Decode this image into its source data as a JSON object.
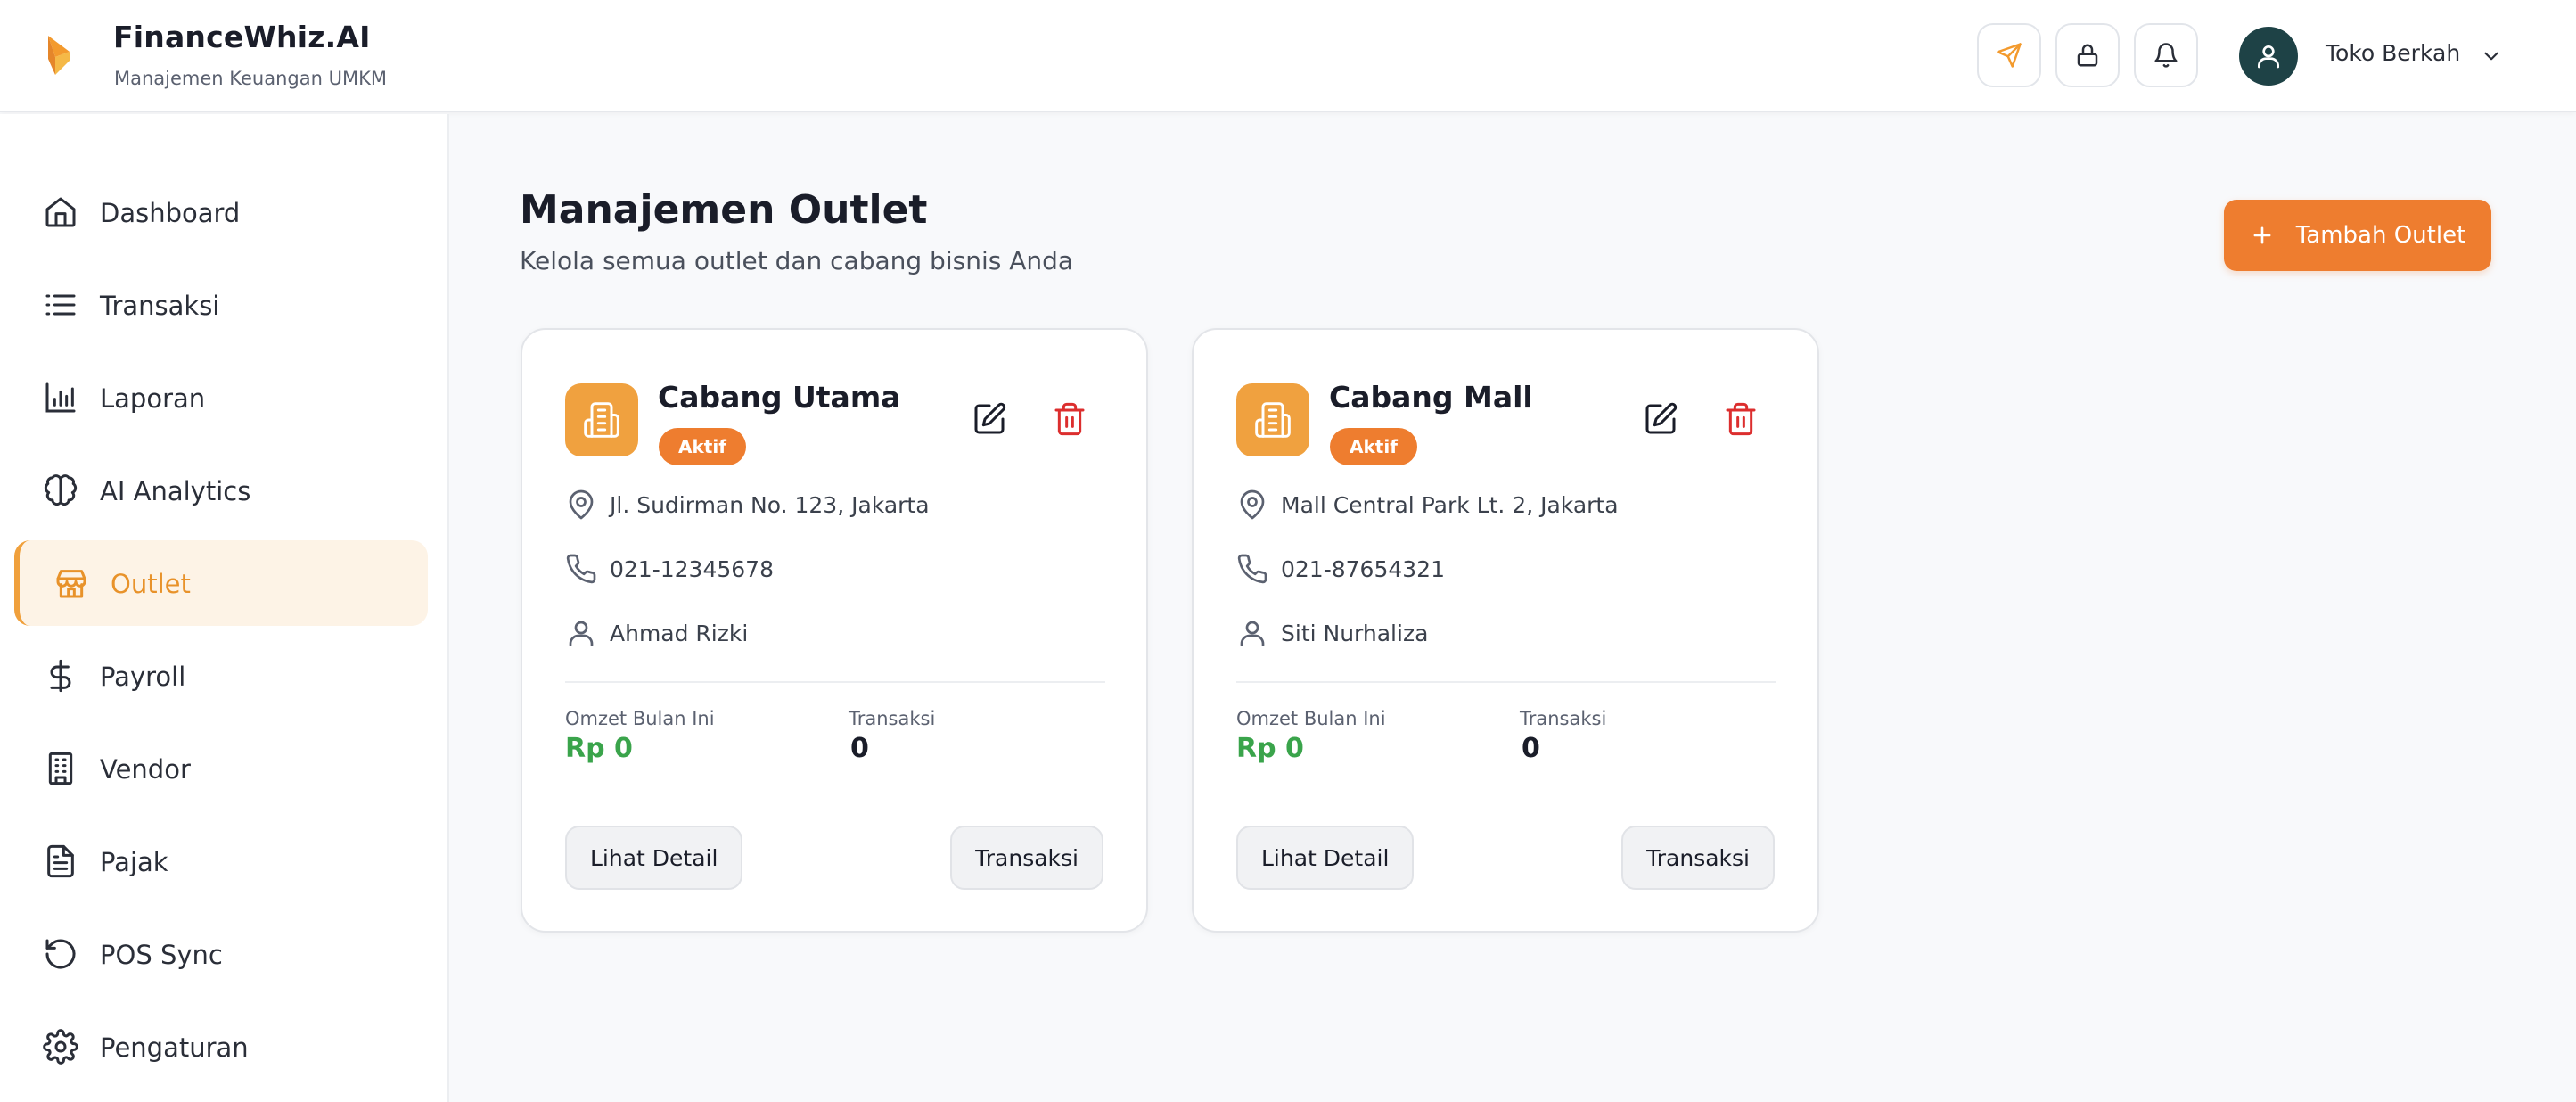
{
  "header": {
    "app_name": "FinanceWhiz.AI",
    "tagline": "Manajemen Keuangan UMKM",
    "user_name": "Toko Berkah",
    "icons": [
      "logo-icon",
      "send-icon",
      "lock-icon",
      "bell-icon",
      "user-icon",
      "chevron-down-icon"
    ]
  },
  "sidebar": {
    "items": [
      {
        "label": "Dashboard",
        "icon": "home-icon"
      },
      {
        "label": "Transaksi",
        "icon": "list-icon"
      },
      {
        "label": "Laporan",
        "icon": "bar-chart-icon"
      },
      {
        "label": "AI Analytics",
        "icon": "brain-icon"
      },
      {
        "label": "Outlet",
        "icon": "store-icon",
        "active": true
      },
      {
        "label": "Payroll",
        "icon": "dollar-icon"
      },
      {
        "label": "Vendor",
        "icon": "building-icon"
      },
      {
        "label": "Pajak",
        "icon": "file-text-icon"
      },
      {
        "label": "POS Sync",
        "icon": "refresh-icon"
      },
      {
        "label": "Pengaturan",
        "icon": "gear-icon"
      }
    ]
  },
  "main": {
    "title": "Manajemen Outlet",
    "subtitle": "Kelola semua outlet dan cabang bisnis Anda",
    "add_button_label": "Tambah Outlet",
    "outlets": [
      {
        "name": "Cabang Utama",
        "status": "Aktif",
        "address": "Jl. Sudirman No. 123, Jakarta",
        "phone": "021-12345678",
        "manager": "Ahmad Rizki",
        "omzet_label": "Omzet Bulan Ini",
        "omzet_value": "Rp 0",
        "transaksi_label": "Transaksi",
        "transaksi_value": "0",
        "detail_button": "Lihat Detail",
        "transaksi_button": "Transaksi"
      },
      {
        "name": "Cabang Mall",
        "status": "Aktif",
        "address": "Mall Central Park Lt. 2, Jakarta",
        "phone": "021-87654321",
        "manager": "Siti Nurhaliza",
        "omzet_label": "Omzet Bulan Ini",
        "omzet_value": "Rp 0",
        "transaksi_label": "Transaksi",
        "transaksi_value": "0",
        "detail_button": "Lihat Detail",
        "transaksi_button": "Transaksi"
      }
    ]
  },
  "colors": {
    "accent": "#ee7d2f",
    "accent_light": "#f0a13f",
    "active_bg": "#fdf3e6",
    "success": "#3aa44b",
    "danger": "#dc2e2e",
    "avatar_bg": "#1e4246"
  }
}
